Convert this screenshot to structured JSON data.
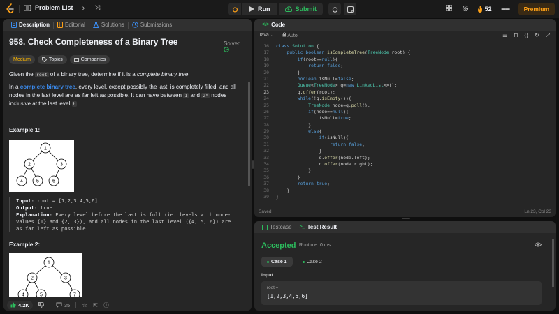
{
  "topbar": {
    "problem_list": "Problem List",
    "prev": "‹",
    "next": "›",
    "shuffle": "⤨",
    "run": "Run",
    "submit": "Submit",
    "streak": "52",
    "premium": "Premium",
    "accent": "#ffa116"
  },
  "left": {
    "tabs": [
      "Description",
      "Editorial",
      "Solutions",
      "Submissions"
    ],
    "title": "958. Check Completeness of a Binary Tree",
    "status": "Solved",
    "tags": [
      "Medium",
      "Topics",
      "Companies"
    ],
    "p1": {
      "a": "Given the ",
      "code": "root",
      "b": " of a binary tree, determine if it is a ",
      "em": "complete binary tree",
      "c": "."
    },
    "p2": {
      "a": "In a ",
      "link": "complete binary tree",
      "b": ", every level, except possibly the last, is completely filled, and all nodes in the last level are as far left as possible. It can have between ",
      "c1": "1",
      "c": " and ",
      "c2": "2ʰ",
      "d": " nodes inclusive at the last level ",
      "c3": "h",
      "e": "."
    },
    "example1": {
      "heading": "Example 1:",
      "input_label": "Input:",
      "input": "root = [1,2,3,4,5,6]",
      "output_label": "Output:",
      "output": "true",
      "explanation_label": "Explanation:",
      "explanation": "Every level before the last is full (ie. levels with node-values {1} and {2, 3}), and all nodes in the last level ({4, 5, 6}) are as far left as possible.",
      "nodes": [
        "1",
        "2",
        "3",
        "4",
        "5",
        "6"
      ]
    },
    "example2": {
      "heading": "Example 2:",
      "nodes": [
        "1",
        "2",
        "3",
        "4",
        "5",
        "7"
      ]
    },
    "footer": {
      "likes": "4.2K",
      "comments": "35"
    }
  },
  "code": {
    "tab": "Code",
    "language": "Java",
    "mode": "Auto",
    "status": "Saved",
    "cursor": "Ln 23, Col 23",
    "current_line": 23,
    "lines": [
      {
        "n": 16,
        "t": "class Solution {"
      },
      {
        "n": 17,
        "t": "    public boolean isCompleteTree(TreeNode root) {"
      },
      {
        "n": 18,
        "t": "        if(root==null){"
      },
      {
        "n": 19,
        "t": "            return false;"
      },
      {
        "n": 20,
        "t": "        }"
      },
      {
        "n": 21,
        "t": "        boolean isNull=false;"
      },
      {
        "n": 22,
        "t": "        Queue<TreeNode> q=new LinkedList<>();"
      },
      {
        "n": 23,
        "t": "        q.offer(root);"
      },
      {
        "n": 24,
        "t": "        while(!q.isEmpty()){"
      },
      {
        "n": 25,
        "t": "            TreeNode node=q.poll();"
      },
      {
        "n": 26,
        "t": "            if(node==null){"
      },
      {
        "n": 27,
        "t": "                isNull=true;"
      },
      {
        "n": 28,
        "t": "            }"
      },
      {
        "n": 29,
        "t": "            else{"
      },
      {
        "n": 30,
        "t": "                if(isNull){"
      },
      {
        "n": 31,
        "t": "                    return false;"
      },
      {
        "n": 32,
        "t": "                }"
      },
      {
        "n": 33,
        "t": "                q.offer(node.left);"
      },
      {
        "n": 34,
        "t": "                q.offer(node.right);"
      },
      {
        "n": 35,
        "t": "            }"
      },
      {
        "n": 36,
        "t": "        }"
      },
      {
        "n": 37,
        "t": "        return true;"
      },
      {
        "n": 38,
        "t": "    }"
      },
      {
        "n": 39,
        "t": "}"
      }
    ]
  },
  "result": {
    "tabs": [
      "Testcase",
      "Test Result"
    ],
    "verdict": "Accepted",
    "runtime": "Runtime: 0 ms",
    "cases": [
      "Case 1",
      "Case 2"
    ],
    "input_label": "Input",
    "var_label": "root =",
    "var_value": "[1,2,3,4,5,6]",
    "accepted_color": "#2cbb5d"
  }
}
